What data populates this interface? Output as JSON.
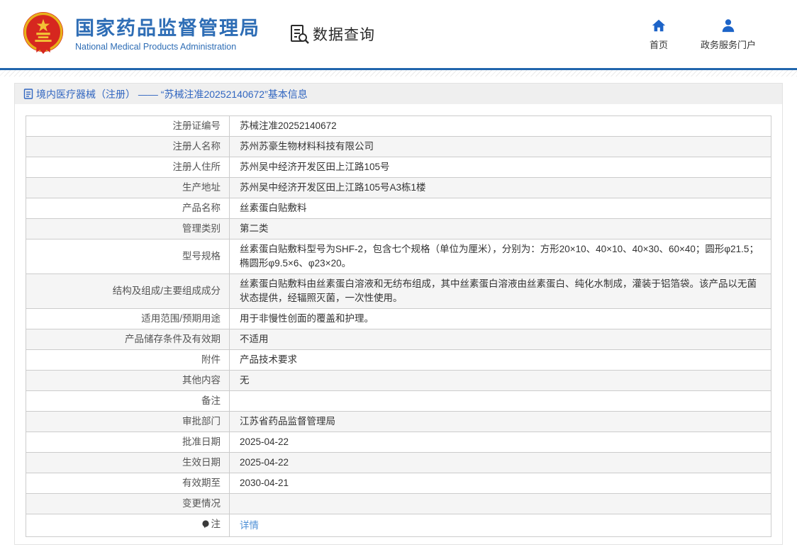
{
  "header": {
    "org_name_cn": "国家药品监督管理局",
    "org_name_en": "National Medical Products Administration",
    "section_title": "数据查询",
    "nav": [
      {
        "icon": "home-icon",
        "label": "首页"
      },
      {
        "icon": "user-icon",
        "label": "政务服务门户"
      }
    ]
  },
  "breadcrumb": {
    "text": "境内医疗器械（注册） —— “苏械注准20252140672”基本信息",
    "icon": "document-icon"
  },
  "table": {
    "rows": [
      {
        "label": "注册证编号",
        "value": "苏械注准20252140672"
      },
      {
        "label": "注册人名称",
        "value": "苏州苏豪生物材料科技有限公司"
      },
      {
        "label": "注册人住所",
        "value": "苏州吴中经济开发区田上江路105号"
      },
      {
        "label": "生产地址",
        "value": "苏州吴中经济开发区田上江路105号A3栋1楼"
      },
      {
        "label": "产品名称",
        "value": "丝素蛋白贴敷料"
      },
      {
        "label": "管理类别",
        "value": "第二类"
      },
      {
        "label": "型号规格",
        "value": "丝素蛋白贴敷料型号为SHF-2，包含七个规格（单位为厘米），分别为：方形20×10、40×10、40×30、60×40；圆形φ21.5；椭圆形φ9.5×6、φ23×20。"
      },
      {
        "label": "结构及组成/主要组成成分",
        "value": "丝素蛋白贴敷料由丝素蛋白溶液和无纺布组成，其中丝素蛋白溶液由丝素蛋白、纯化水制成，灌装于铝箔袋。该产品以无菌状态提供，经辐照灭菌，一次性使用。"
      },
      {
        "label": "适用范围/预期用途",
        "value": "用于非慢性创面的覆盖和护理。"
      },
      {
        "label": "产品储存条件及有效期",
        "value": "不适用"
      },
      {
        "label": "附件",
        "value": "产品技术要求"
      },
      {
        "label": "其他内容",
        "value": "无"
      },
      {
        "label": "备注",
        "value": ""
      },
      {
        "label": "审批部门",
        "value": "江苏省药品监督管理局"
      },
      {
        "label": "批准日期",
        "value": "2025-04-22"
      },
      {
        "label": "生效日期",
        "value": "2025-04-22"
      },
      {
        "label": "有效期至",
        "value": "2030-04-21"
      },
      {
        "label": "变更情况",
        "value": ""
      },
      {
        "label": "注",
        "value": "详情",
        "value_is_link": true,
        "label_icon": "bulb-icon"
      }
    ]
  },
  "colors": {
    "accent_blue": "#2166ad",
    "title_blue": "#2e6db5",
    "breadcrumb_blue": "#3166c0",
    "link_blue": "#4d8fd6",
    "emblem_red": "#d6271f",
    "emblem_gold": "#e8b21a",
    "row_alt_bg": "#f5f5f5",
    "breadcrumb_bg": "#efefef",
    "table_border": "#cccccc"
  }
}
